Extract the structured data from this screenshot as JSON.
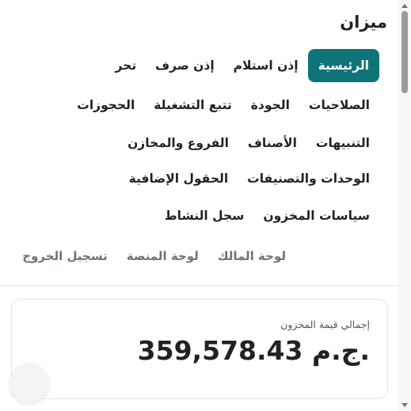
{
  "app": {
    "brand": "ميزان"
  },
  "nav": {
    "row1": [
      "الرئيسية",
      "إذن استلام",
      "إذن صرف",
      "تحر"
    ],
    "row2": [
      "الصلاحيات",
      "الجودة",
      "تتبع التشغيلة",
      "الحجوزات"
    ],
    "row3": [
      "التنبيهات",
      "الأصناف",
      "الفروع والمخازن"
    ],
    "row4": [
      "الوحدات والتصنيفات",
      "الحقول الإضافية"
    ],
    "row5": [
      "سياسات المخزون",
      "سجل النشاط"
    ],
    "secondary": [
      "لوحة المالك",
      "لوحة المنصة",
      "تسجيل الخروج"
    ]
  },
  "summary": {
    "label": "إجمالي قيمة المخزون",
    "value": "359,578.43 ج.م."
  },
  "colors": {
    "accent": "#0f7478"
  }
}
